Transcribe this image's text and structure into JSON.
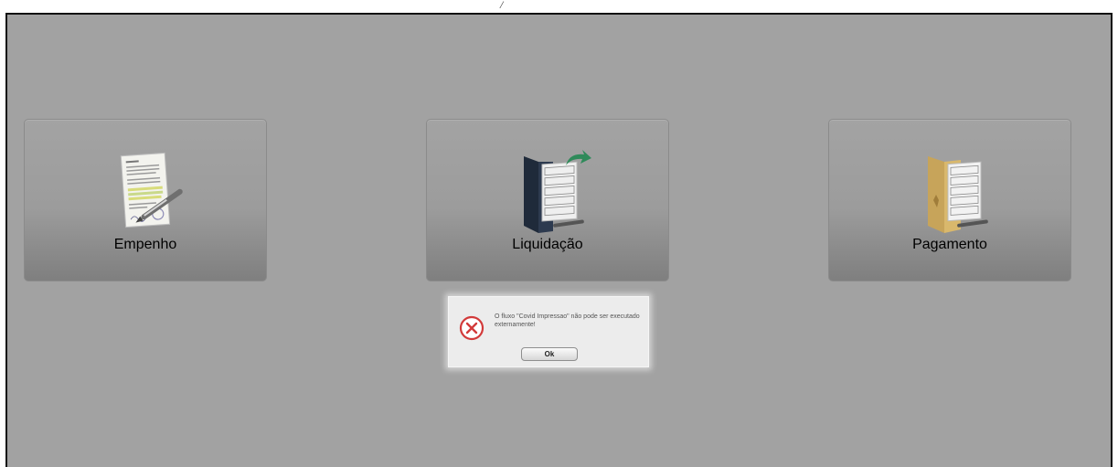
{
  "top_mark": "/",
  "tiles": [
    {
      "label": "Empenho",
      "icon": "signed-document-pen-icon"
    },
    {
      "label": "Liquidação",
      "icon": "dark-folder-documents-arrow-icon"
    },
    {
      "label": "Pagamento",
      "icon": "tan-folder-documents-pen-icon"
    }
  ],
  "dialog": {
    "icon": "error-x-icon",
    "message": "O fluxo \"Covid Impressao\" não pode ser executado externamente!",
    "ok_label": "Ok"
  },
  "colors": {
    "background": "#a2a2a2",
    "tile": "#9c9c9c",
    "dialog": "#ececec",
    "error": "#d23a3a"
  }
}
